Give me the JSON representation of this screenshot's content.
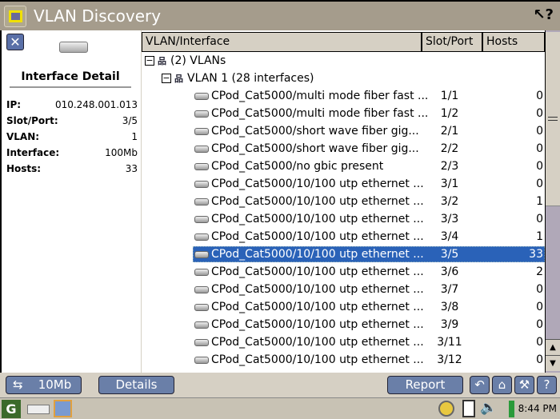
{
  "window": {
    "title": "VLAN Discovery",
    "help_icon": "context-help-icon"
  },
  "detail": {
    "title": "Interface Detail",
    "fields": [
      {
        "label": "IP:",
        "value": "010.248.001.013"
      },
      {
        "label": "Slot/Port:",
        "value": "3/5"
      },
      {
        "label": "VLAN:",
        "value": "1"
      },
      {
        "label": "Interface:",
        "value": "100Mb"
      },
      {
        "label": "Hosts:",
        "value": "33"
      }
    ]
  },
  "table": {
    "columns": [
      "VLAN/Interface",
      "Slot/Port",
      "Hosts"
    ],
    "root": "(2) VLANs",
    "vlan": "VLAN 1 (28 interfaces)",
    "rows": [
      {
        "name": "CPod_Cat5000/multi mode fiber fast ...",
        "slot": "1/1",
        "hosts": "0"
      },
      {
        "name": "CPod_Cat5000/multi mode fiber fast ...",
        "slot": "1/2",
        "hosts": "0"
      },
      {
        "name": "CPod_Cat5000/short wave fiber gig...",
        "slot": "2/1",
        "hosts": "0"
      },
      {
        "name": "CPod_Cat5000/short wave fiber gig...",
        "slot": "2/2",
        "hosts": "0"
      },
      {
        "name": "CPod_Cat5000/no gbic present",
        "slot": "2/3",
        "hosts": "0"
      },
      {
        "name": "CPod_Cat5000/10/100 utp ethernet ...",
        "slot": "3/1",
        "hosts": "0"
      },
      {
        "name": "CPod_Cat5000/10/100 utp ethernet ...",
        "slot": "3/2",
        "hosts": "1"
      },
      {
        "name": "CPod_Cat5000/10/100 utp ethernet ...",
        "slot": "3/3",
        "hosts": "0"
      },
      {
        "name": "CPod_Cat5000/10/100 utp ethernet ...",
        "slot": "3/4",
        "hosts": "1"
      },
      {
        "name": "CPod_Cat5000/10/100 utp ethernet ...",
        "slot": "3/5",
        "hosts": "33",
        "selected": true
      },
      {
        "name": "CPod_Cat5000/10/100 utp ethernet ...",
        "slot": "3/6",
        "hosts": "2"
      },
      {
        "name": "CPod_Cat5000/10/100 utp ethernet ...",
        "slot": "3/7",
        "hosts": "0"
      },
      {
        "name": "CPod_Cat5000/10/100 utp ethernet ...",
        "slot": "3/8",
        "hosts": "0"
      },
      {
        "name": "CPod_Cat5000/10/100 utp ethernet ...",
        "slot": "3/9",
        "hosts": "0"
      },
      {
        "name": "CPod_Cat5000/10/100 utp ethernet ...",
        "slot": "3/11",
        "hosts": "0"
      },
      {
        "name": "CPod_Cat5000/10/100 utp ethernet ...",
        "slot": "3/12",
        "hosts": "0"
      }
    ]
  },
  "toolbar": {
    "speed": "10Mb",
    "details": "Details",
    "report": "Report"
  },
  "taskbar": {
    "clock": "8:44 PM"
  },
  "colors": {
    "selection": "#2a62b8",
    "button": "#6a7fa8",
    "titlebar": "#a59c8c"
  }
}
